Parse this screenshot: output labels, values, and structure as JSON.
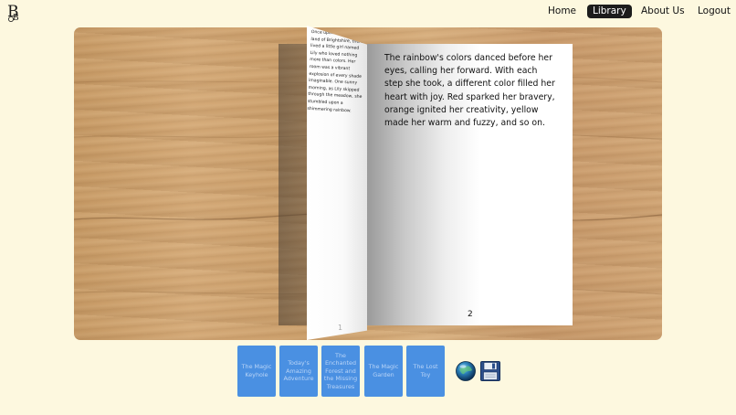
{
  "nav": {
    "home": "Home",
    "library": "Library",
    "about": "About Us",
    "logout": "Logout"
  },
  "book": {
    "left_page_text": "Once upon a time, in the land of Brightshire, there lived a little girl named Lily who loved nothing more than colors. Her room was a vibrant explosion of every shade imaginable. One sunny morning, as Lily skipped through the meadow, she stumbled upon a shimmering rainbow.",
    "left_page_number": "1",
    "right_page_text": "The rainbow's colors danced before her eyes, calling her forward. With each step she took, a different color filled her heart with joy. Red sparked her bravery, orange ignited her creativity, yellow made her warm and fuzzy, and so on.",
    "right_page_number": "2"
  },
  "library_books": [
    "The Magic Keyhole",
    "Today's Amazing Adventure",
    "The Enchanted Forest and the Missing Treasures",
    "The Magic Garden",
    "The Lost Toy"
  ],
  "icons": {
    "logo": "logo-icon",
    "globe": "globe-icon",
    "save": "save-icon"
  },
  "colors": {
    "background": "#fdf8df",
    "card": "#4a90e2",
    "card_text": "#b9d4f7",
    "nav_active": "#1c1c1c"
  }
}
